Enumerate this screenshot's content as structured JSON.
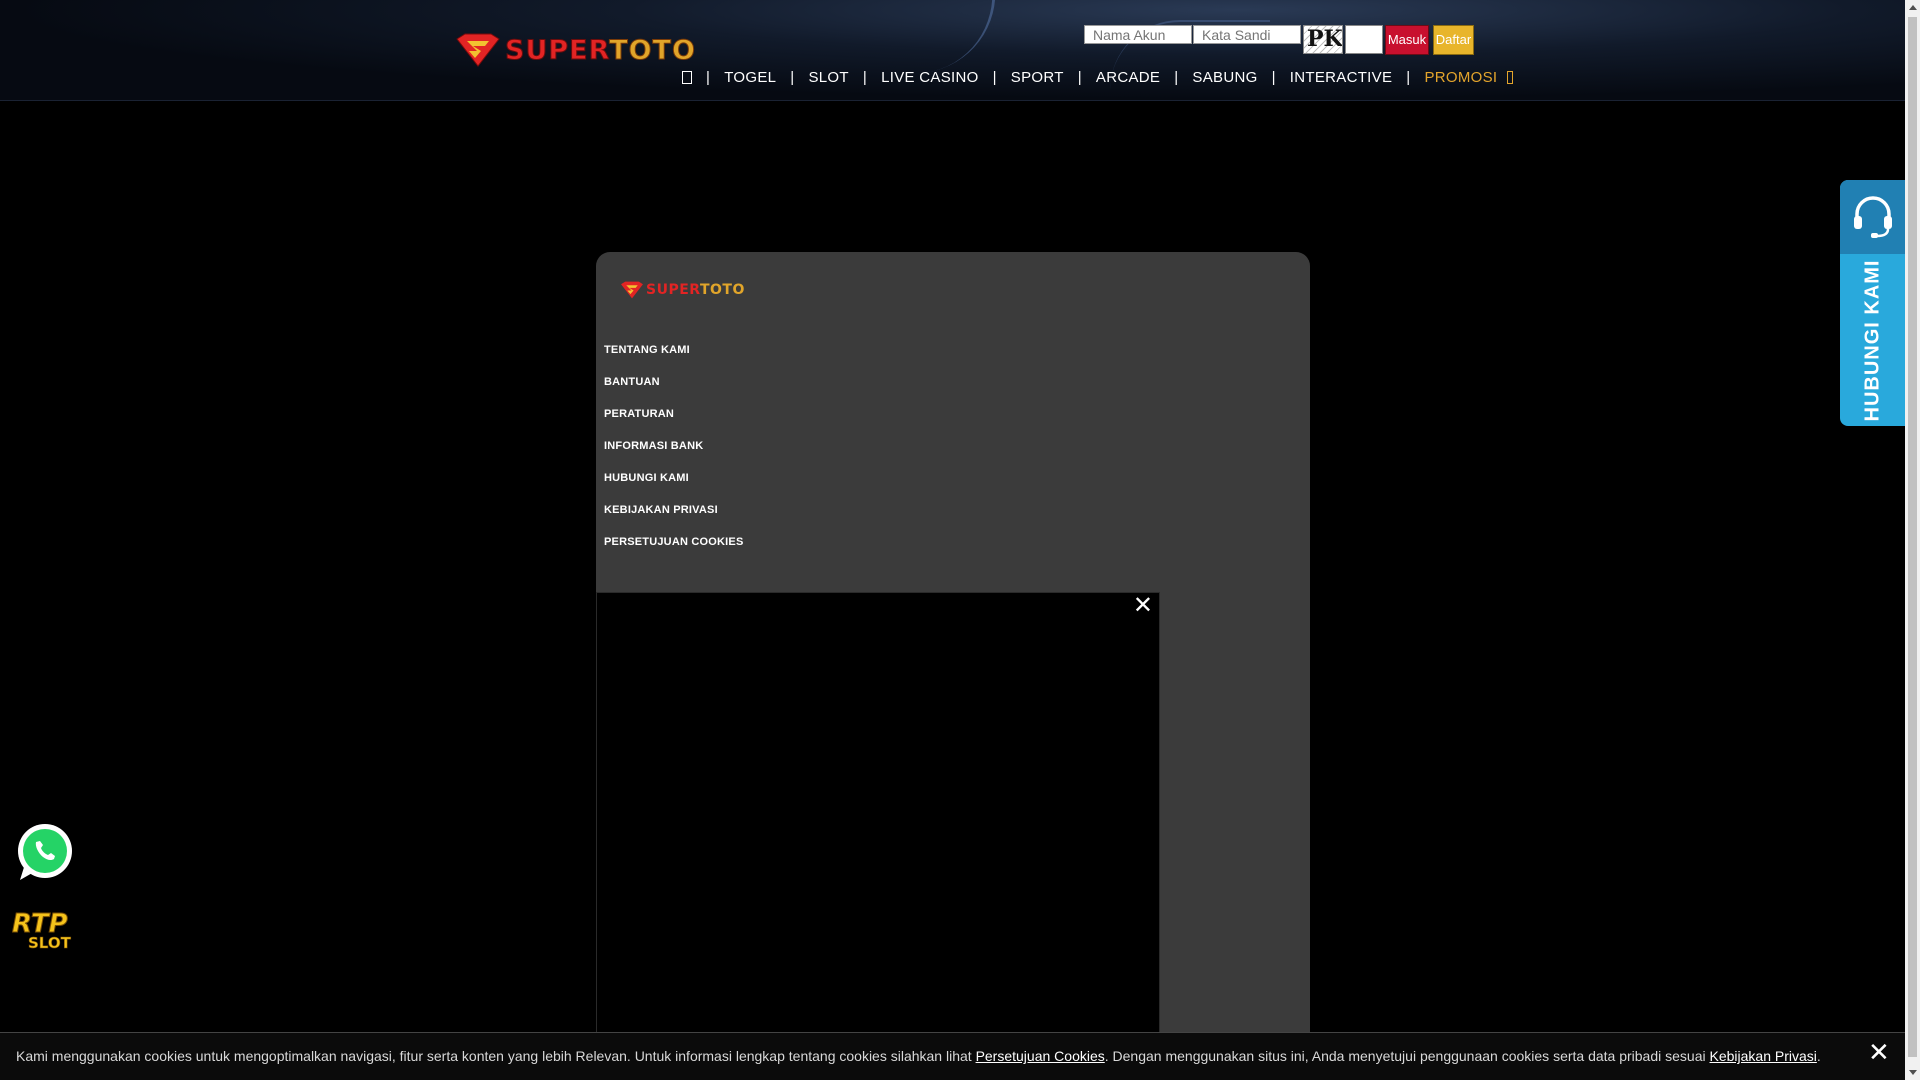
{
  "brand": {
    "part1": "SUPER",
    "part2": "TOTO",
    "logo_colors": {
      "red": "#e22424",
      "gold": "#e1a52a"
    }
  },
  "login": {
    "username_placeholder": "Nama Akun",
    "password_placeholder": "Kata Sandi",
    "captcha_text": "PK",
    "masuk_label": "Masuk",
    "daftar_label": "Daftar",
    "masuk_color": "#c8102e",
    "daftar_color": "#e8b52b"
  },
  "nav": {
    "home_icon": "home-icon",
    "items": [
      "TOGEL",
      "SLOT",
      "LIVE CASINO",
      "SPORT",
      "ARCADE",
      "SABUNG",
      "INTERACTIVE",
      "PROMOSI"
    ],
    "separator": "|",
    "promo_icon": "gift-icon",
    "promo_color": "#e4a52c"
  },
  "panel": {
    "links": [
      "TENTANG KAMI",
      "BANTUAN",
      "PERATURAN",
      "INFORMASI BANK",
      "HUBUNGI KAMI",
      "KEBIJAKAN PRIVASI",
      "PERSETUJUAN COOKIES"
    ]
  },
  "video": {
    "close_symbol": "✕",
    "close_icon": "close-icon"
  },
  "contact_tab": {
    "label": "HUBUNGI KAMI",
    "icon": "headset-icon",
    "color": "#29a9dc"
  },
  "floating": {
    "whatsapp_icon": "whatsapp-icon",
    "rtp_line1": "RTP",
    "rtp_line2": "SLOT"
  },
  "cookie": {
    "text_before": "Kami menggunakan cookies untuk mengoptimalkan navigasi, fitur serta konten yang lebih Relevan. Untuk informasi lengkap tentang cookies silahkan lihat ",
    "link1": "Persetujuan Cookies",
    "text_middle": ". Dengan menggunakan situs ini, Anda menyetujui penggunaan cookies serta data pribadi sesuai ",
    "link2": "Kebijakan Privasi",
    "text_after": ".",
    "close_symbol": "✕"
  }
}
